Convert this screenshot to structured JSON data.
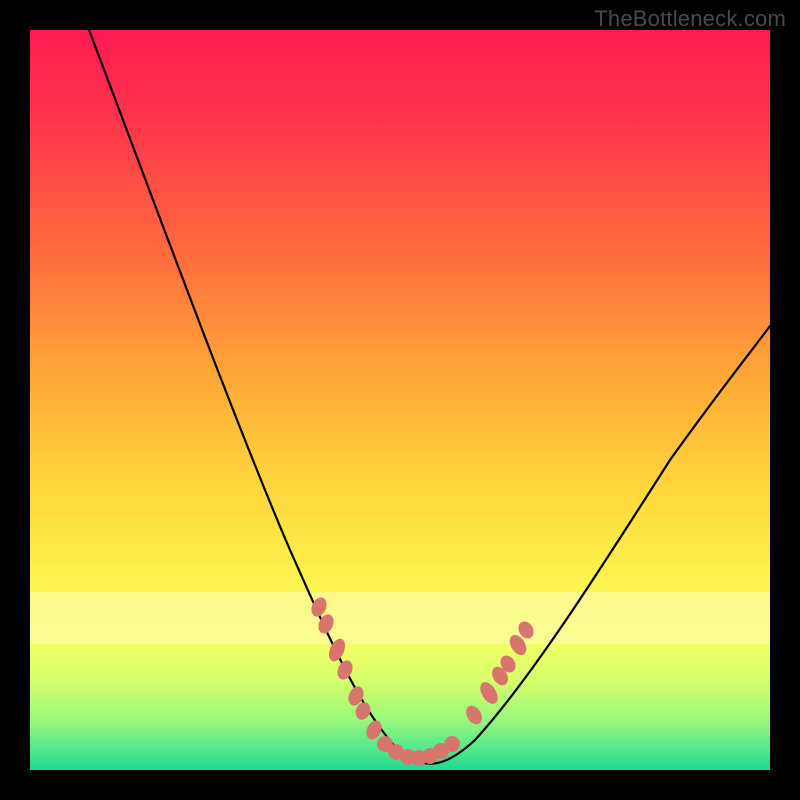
{
  "watermark": "TheBottleneck.com",
  "colors": {
    "frame": "#000000",
    "bead": "#d8766d",
    "curve": "#000000",
    "gradient_top": "#ff1a52",
    "gradient_bottom": "#1fd890",
    "pale_band": "#fcfab6"
  },
  "chart_data": {
    "type": "line",
    "title": "",
    "xlabel": "",
    "ylabel": "",
    "xlim": [
      0,
      100
    ],
    "ylim": [
      0,
      100
    ],
    "note": "No axis ticks or numeric labels are rendered in the image; values below are estimated from pixel positions on a 0-100 normalized scale where y=0 is bottom (green) and y=100 is top (red).",
    "curve_points": [
      {
        "x": 8,
        "y": 100
      },
      {
        "x": 14,
        "y": 87
      },
      {
        "x": 20,
        "y": 72
      },
      {
        "x": 26,
        "y": 56
      },
      {
        "x": 32,
        "y": 40
      },
      {
        "x": 36,
        "y": 28
      },
      {
        "x": 40,
        "y": 17
      },
      {
        "x": 44,
        "y": 8
      },
      {
        "x": 48,
        "y": 3
      },
      {
        "x": 52,
        "y": 1
      },
      {
        "x": 56,
        "y": 2
      },
      {
        "x": 60,
        "y": 6
      },
      {
        "x": 66,
        "y": 16
      },
      {
        "x": 74,
        "y": 30
      },
      {
        "x": 84,
        "y": 46
      },
      {
        "x": 94,
        "y": 58
      },
      {
        "x": 100,
        "y": 63
      }
    ],
    "beads_left": [
      {
        "x": 39,
        "y": 22
      },
      {
        "x": 40,
        "y": 19
      },
      {
        "x": 41.5,
        "y": 15.5
      },
      {
        "x": 42.5,
        "y": 13
      },
      {
        "x": 44,
        "y": 9
      },
      {
        "x": 45,
        "y": 7
      },
      {
        "x": 46.5,
        "y": 4.5
      }
    ],
    "beads_bottom": [
      {
        "x": 48,
        "y": 2.5
      },
      {
        "x": 49.5,
        "y": 1.7
      },
      {
        "x": 51,
        "y": 1.2
      },
      {
        "x": 52.5,
        "y": 1.2
      },
      {
        "x": 54,
        "y": 1.7
      },
      {
        "x": 55.5,
        "y": 2.6
      },
      {
        "x": 57,
        "y": 3.8
      }
    ],
    "beads_right": [
      {
        "x": 60,
        "y": 8
      },
      {
        "x": 62,
        "y": 11.5
      },
      {
        "x": 63.5,
        "y": 14
      },
      {
        "x": 64.5,
        "y": 16
      },
      {
        "x": 66,
        "y": 19
      },
      {
        "x": 67,
        "y": 21
      }
    ],
    "pale_band_y": [
      17,
      24
    ]
  }
}
